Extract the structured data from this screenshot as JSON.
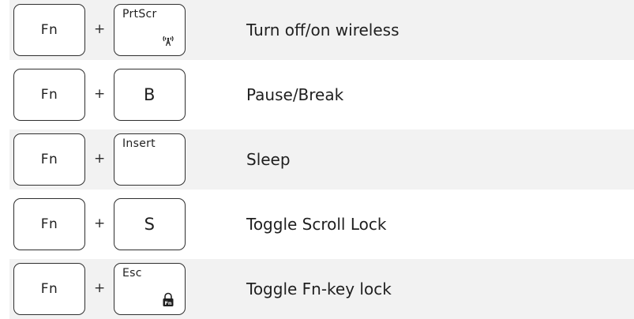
{
  "rows": [
    {
      "fn_label": "Fn",
      "plus": "+",
      "key_label": "PrtScr",
      "key_icon": "wireless-antenna-icon",
      "description": "Turn off/on wireless"
    },
    {
      "fn_label": "Fn",
      "plus": "+",
      "key_label": "B",
      "description": "Pause/Break"
    },
    {
      "fn_label": "Fn",
      "plus": "+",
      "key_label": "Insert",
      "description": "Sleep"
    },
    {
      "fn_label": "Fn",
      "plus": "+",
      "key_label": "S",
      "description": "Toggle Scroll Lock"
    },
    {
      "fn_label": "Fn",
      "plus": "+",
      "key_label": "Esc",
      "key_icon": "fn-lock-icon",
      "key_icon_text": "Fn",
      "description": "Toggle Fn-key lock"
    }
  ],
  "colors": {
    "row_shade": "#f2f2f2",
    "text": "#1f1f1f",
    "key_border": "#2f2f2f"
  }
}
